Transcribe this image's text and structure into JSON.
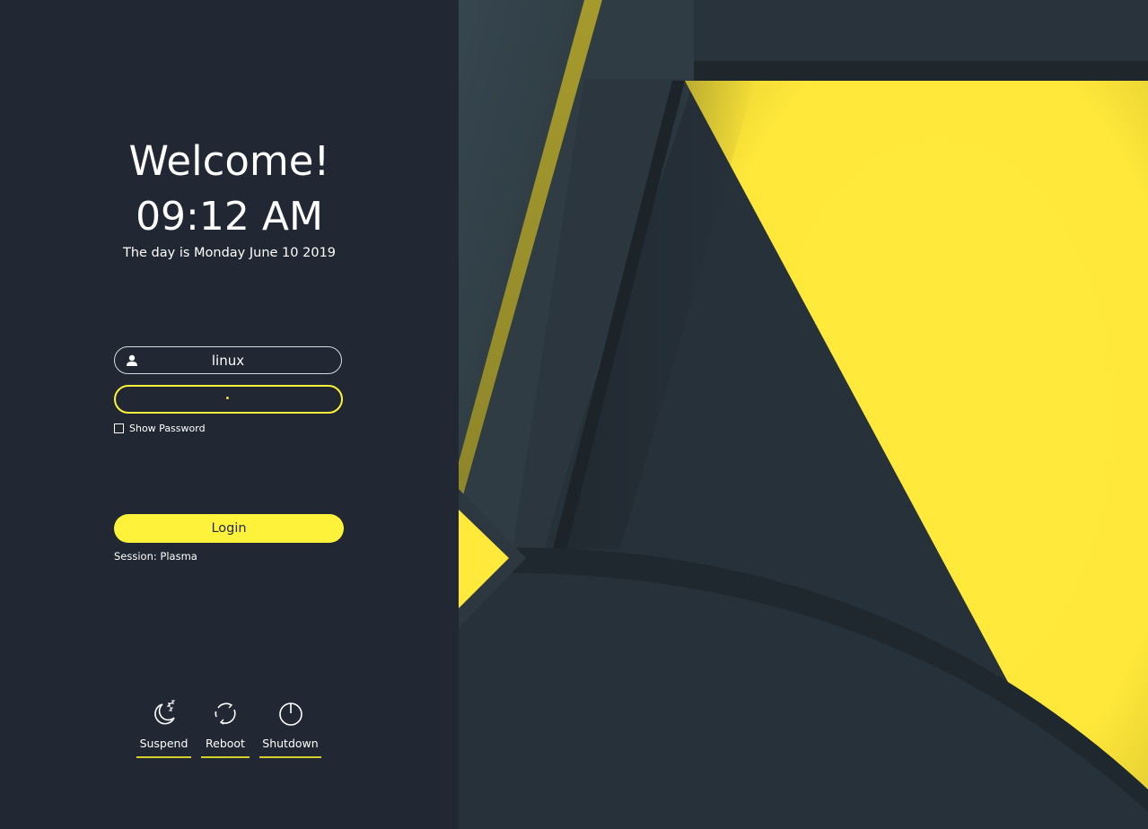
{
  "greeting": {
    "welcome": "Welcome!",
    "time": "09:12 AM",
    "date": "The day is Monday June 10 2019"
  },
  "login_form": {
    "username": "linux",
    "password_mask": "•",
    "show_password_label": "Show Password",
    "login_label": "Login",
    "session_label": "Session: Plasma"
  },
  "power_actions": {
    "suspend_label": "Suspend",
    "reboot_label": "Reboot",
    "shutdown_label": "Shutdown"
  },
  "icons": {
    "user": "user-icon",
    "suspend": "moon-sleep-icon",
    "reboot": "reboot-icon",
    "shutdown": "power-icon"
  },
  "colors": {
    "panel_background": "#212833",
    "accent": "#fff23a",
    "text": "#ffffff",
    "wallpaper_dark": "#28313a",
    "wallpaper_yellow": "#ffe93a"
  }
}
